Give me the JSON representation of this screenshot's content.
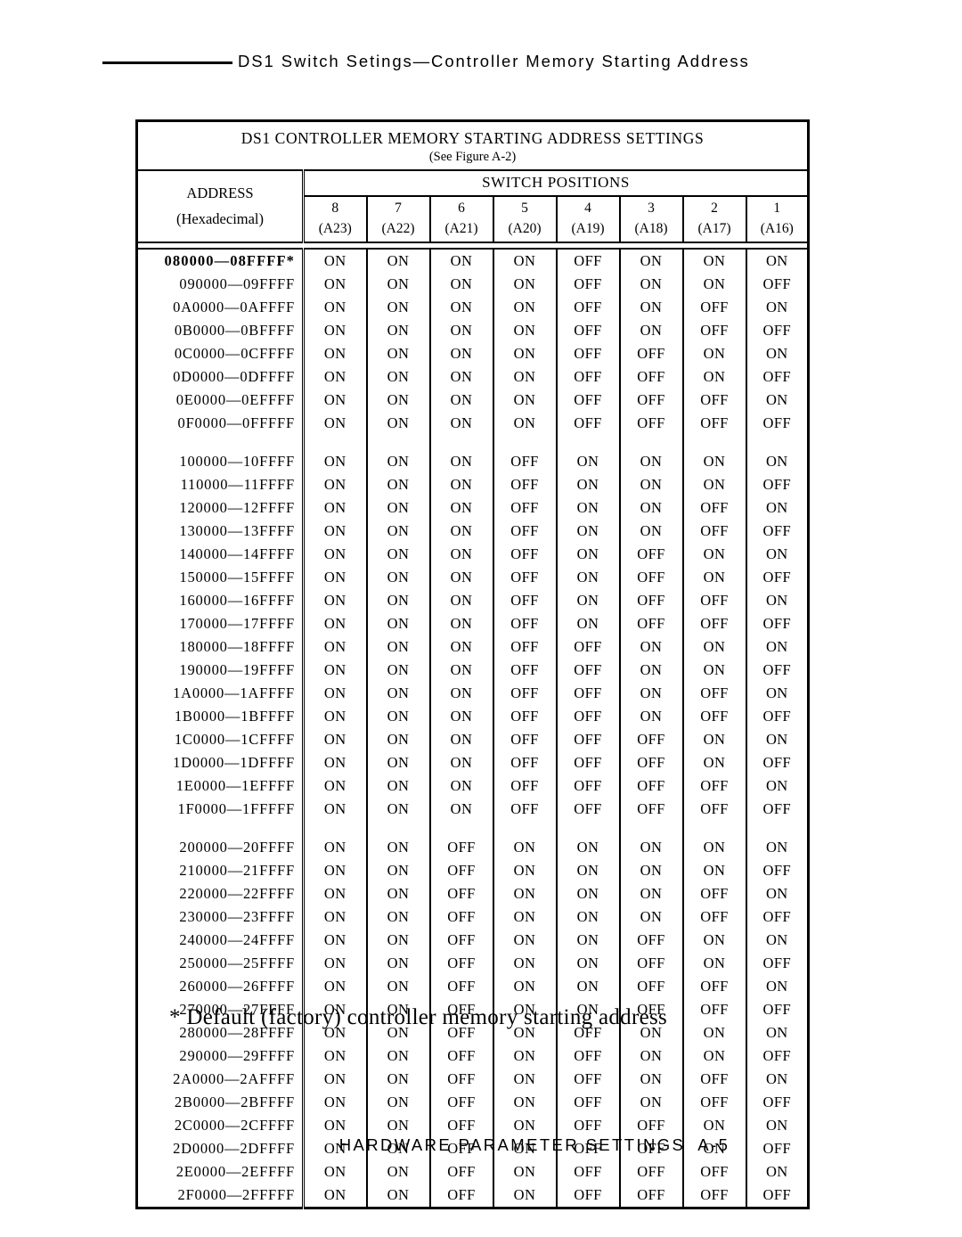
{
  "running_head": {
    "title": "DS1 Switch Setings—Controller Memory Starting Address"
  },
  "table": {
    "title": "DS1  CONTROLLER  MEMORY  STARTING  ADDRESS  SETTINGS",
    "subtitle": "(See Figure A-2)",
    "address_header": "ADDRESS",
    "address_subheader": "(Hexadecimal)",
    "switch_header": "SWITCH   POSITIONS",
    "switch_columns": [
      {
        "number": "8",
        "signal": "(A23)"
      },
      {
        "number": "7",
        "signal": "(A22)"
      },
      {
        "number": "6",
        "signal": "(A21)"
      },
      {
        "number": "5",
        "signal": "(A20)"
      },
      {
        "number": "4",
        "signal": "(A19)"
      },
      {
        "number": "3",
        "signal": "(A18)"
      },
      {
        "number": "2",
        "signal": "(A17)"
      },
      {
        "number": "1",
        "signal": "(A16)"
      }
    ],
    "groups": [
      {
        "rows": [
          {
            "address": "080000—08FFFF*",
            "default": true,
            "switches": [
              "ON",
              "ON",
              "ON",
              "ON",
              "OFF",
              "ON",
              "ON",
              "ON"
            ]
          },
          {
            "address": "090000—09FFFF",
            "default": false,
            "switches": [
              "ON",
              "ON",
              "ON",
              "ON",
              "OFF",
              "ON",
              "ON",
              "OFF"
            ]
          },
          {
            "address": "0A0000—0AFFFF",
            "default": false,
            "switches": [
              "ON",
              "ON",
              "ON",
              "ON",
              "OFF",
              "ON",
              "OFF",
              "ON"
            ]
          },
          {
            "address": "0B0000—0BFFFF",
            "default": false,
            "switches": [
              "ON",
              "ON",
              "ON",
              "ON",
              "OFF",
              "ON",
              "OFF",
              "OFF"
            ]
          },
          {
            "address": "0C0000—0CFFFF",
            "default": false,
            "switches": [
              "ON",
              "ON",
              "ON",
              "ON",
              "OFF",
              "OFF",
              "ON",
              "ON"
            ]
          },
          {
            "address": "0D0000—0DFFFF",
            "default": false,
            "switches": [
              "ON",
              "ON",
              "ON",
              "ON",
              "OFF",
              "OFF",
              "ON",
              "OFF"
            ]
          },
          {
            "address": "0E0000—0EFFFF",
            "default": false,
            "switches": [
              "ON",
              "ON",
              "ON",
              "ON",
              "OFF",
              "OFF",
              "OFF",
              "ON"
            ]
          },
          {
            "address": "0F0000—0FFFFF",
            "default": false,
            "switches": [
              "ON",
              "ON",
              "ON",
              "ON",
              "OFF",
              "OFF",
              "OFF",
              "OFF"
            ]
          }
        ]
      },
      {
        "rows": [
          {
            "address": "100000—10FFFF",
            "default": false,
            "switches": [
              "ON",
              "ON",
              "ON",
              "OFF",
              "ON",
              "ON",
              "ON",
              "ON"
            ]
          },
          {
            "address": "110000—11FFFF",
            "default": false,
            "switches": [
              "ON",
              "ON",
              "ON",
              "OFF",
              "ON",
              "ON",
              "ON",
              "OFF"
            ]
          },
          {
            "address": "120000—12FFFF",
            "default": false,
            "switches": [
              "ON",
              "ON",
              "ON",
              "OFF",
              "ON",
              "ON",
              "OFF",
              "ON"
            ]
          },
          {
            "address": "130000—13FFFF",
            "default": false,
            "switches": [
              "ON",
              "ON",
              "ON",
              "OFF",
              "ON",
              "ON",
              "OFF",
              "OFF"
            ]
          },
          {
            "address": "140000—14FFFF",
            "default": false,
            "switches": [
              "ON",
              "ON",
              "ON",
              "OFF",
              "ON",
              "OFF",
              "ON",
              "ON"
            ]
          },
          {
            "address": "150000—15FFFF",
            "default": false,
            "switches": [
              "ON",
              "ON",
              "ON",
              "OFF",
              "ON",
              "OFF",
              "ON",
              "OFF"
            ]
          },
          {
            "address": "160000—16FFFF",
            "default": false,
            "switches": [
              "ON",
              "ON",
              "ON",
              "OFF",
              "ON",
              "OFF",
              "OFF",
              "ON"
            ]
          },
          {
            "address": "170000—17FFFF",
            "default": false,
            "switches": [
              "ON",
              "ON",
              "ON",
              "OFF",
              "ON",
              "OFF",
              "OFF",
              "OFF"
            ]
          },
          {
            "address": "180000—18FFFF",
            "default": false,
            "switches": [
              "ON",
              "ON",
              "ON",
              "OFF",
              "OFF",
              "ON",
              "ON",
              "ON"
            ]
          },
          {
            "address": "190000—19FFFF",
            "default": false,
            "switches": [
              "ON",
              "ON",
              "ON",
              "OFF",
              "OFF",
              "ON",
              "ON",
              "OFF"
            ]
          },
          {
            "address": "1A0000—1AFFFF",
            "default": false,
            "switches": [
              "ON",
              "ON",
              "ON",
              "OFF",
              "OFF",
              "ON",
              "OFF",
              "ON"
            ]
          },
          {
            "address": "1B0000—1BFFFF",
            "default": false,
            "switches": [
              "ON",
              "ON",
              "ON",
              "OFF",
              "OFF",
              "ON",
              "OFF",
              "OFF"
            ]
          },
          {
            "address": "1C0000—1CFFFF",
            "default": false,
            "switches": [
              "ON",
              "ON",
              "ON",
              "OFF",
              "OFF",
              "OFF",
              "ON",
              "ON"
            ]
          },
          {
            "address": "1D0000—1DFFFF",
            "default": false,
            "switches": [
              "ON",
              "ON",
              "ON",
              "OFF",
              "OFF",
              "OFF",
              "ON",
              "OFF"
            ]
          },
          {
            "address": "1E0000—1EFFFF",
            "default": false,
            "switches": [
              "ON",
              "ON",
              "ON",
              "OFF",
              "OFF",
              "OFF",
              "OFF",
              "ON"
            ]
          },
          {
            "address": "1F0000—1FFFFF",
            "default": false,
            "switches": [
              "ON",
              "ON",
              "ON",
              "OFF",
              "OFF",
              "OFF",
              "OFF",
              "OFF"
            ]
          }
        ]
      },
      {
        "rows": [
          {
            "address": "200000—20FFFF",
            "default": false,
            "switches": [
              "ON",
              "ON",
              "OFF",
              "ON",
              "ON",
              "ON",
              "ON",
              "ON"
            ]
          },
          {
            "address": "210000—21FFFF",
            "default": false,
            "switches": [
              "ON",
              "ON",
              "OFF",
              "ON",
              "ON",
              "ON",
              "ON",
              "OFF"
            ]
          },
          {
            "address": "220000—22FFFF",
            "default": false,
            "switches": [
              "ON",
              "ON",
              "OFF",
              "ON",
              "ON",
              "ON",
              "OFF",
              "ON"
            ]
          },
          {
            "address": "230000—23FFFF",
            "default": false,
            "switches": [
              "ON",
              "ON",
              "OFF",
              "ON",
              "ON",
              "ON",
              "OFF",
              "OFF"
            ]
          },
          {
            "address": "240000—24FFFF",
            "default": false,
            "switches": [
              "ON",
              "ON",
              "OFF",
              "ON",
              "ON",
              "OFF",
              "ON",
              "ON"
            ]
          },
          {
            "address": "250000—25FFFF",
            "default": false,
            "switches": [
              "ON",
              "ON",
              "OFF",
              "ON",
              "ON",
              "OFF",
              "ON",
              "OFF"
            ]
          },
          {
            "address": "260000—26FFFF",
            "default": false,
            "switches": [
              "ON",
              "ON",
              "OFF",
              "ON",
              "ON",
              "OFF",
              "OFF",
              "ON"
            ]
          },
          {
            "address": "270000—27FFFF",
            "default": false,
            "switches": [
              "ON",
              "ON",
              "OFF",
              "ON",
              "ON",
              "OFF",
              "OFF",
              "OFF"
            ]
          },
          {
            "address": "280000—28FFFF",
            "default": false,
            "switches": [
              "ON",
              "ON",
              "OFF",
              "ON",
              "OFF",
              "ON",
              "ON",
              "ON"
            ]
          },
          {
            "address": "290000—29FFFF",
            "default": false,
            "switches": [
              "ON",
              "ON",
              "OFF",
              "ON",
              "OFF",
              "ON",
              "ON",
              "OFF"
            ]
          },
          {
            "address": "2A0000—2AFFFF",
            "default": false,
            "switches": [
              "ON",
              "ON",
              "OFF",
              "ON",
              "OFF",
              "ON",
              "OFF",
              "ON"
            ]
          },
          {
            "address": "2B0000—2BFFFF",
            "default": false,
            "switches": [
              "ON",
              "ON",
              "OFF",
              "ON",
              "OFF",
              "ON",
              "OFF",
              "OFF"
            ]
          },
          {
            "address": "2C0000—2CFFFF",
            "default": false,
            "switches": [
              "ON",
              "ON",
              "OFF",
              "ON",
              "OFF",
              "OFF",
              "ON",
              "ON"
            ]
          },
          {
            "address": "2D0000—2DFFFF",
            "default": false,
            "switches": [
              "ON",
              "ON",
              "OFF",
              "ON",
              "OFF",
              "OFF",
              "ON",
              "OFF"
            ]
          },
          {
            "address": "2E0000—2EFFFF",
            "default": false,
            "switches": [
              "ON",
              "ON",
              "OFF",
              "ON",
              "OFF",
              "OFF",
              "OFF",
              "ON"
            ]
          },
          {
            "address": "2F0000—2FFFFF",
            "default": false,
            "switches": [
              "ON",
              "ON",
              "OFF",
              "ON",
              "OFF",
              "OFF",
              "OFF",
              "OFF"
            ]
          }
        ]
      }
    ]
  },
  "footnote": "* Default (factory) controller memory starting address",
  "footer": {
    "title": "HARDWARE PARAMETER SETTINGS",
    "folio": "A-5"
  }
}
